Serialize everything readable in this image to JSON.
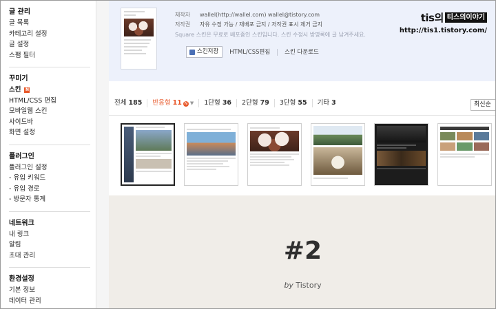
{
  "sidebar": {
    "sections": [
      {
        "title": "글 관리",
        "items": [
          "글 목록",
          "카테고리 설정",
          "글 설정",
          "스팸 필터"
        ]
      },
      {
        "title": "꾸미기",
        "items": [
          "스킨",
          "HTML/CSS 편집",
          "모바일웹 스킨",
          "사이드바",
          "화면 설정"
        ]
      },
      {
        "title": "플러그인",
        "items": [
          "플러그인 설정",
          "- 유입 키워드",
          "- 유입 경로",
          "- 방문자 통계"
        ]
      },
      {
        "title": "네트워크",
        "items": [
          "내 링크",
          "알림",
          "초대 관리"
        ]
      },
      {
        "title": "환경설정",
        "items": [
          "기본 정보",
          "데이터 관리"
        ]
      }
    ],
    "active_item": "스킨",
    "new_badge": "N"
  },
  "skin_info": {
    "maker_label": "제작자",
    "maker_value": "wallel(http://wallel.com) wallel@tistory.com",
    "copyright_label": "저작권",
    "copyright_value": "자유 수정 가능 / 재배포 금지 / 저작권 표시 제거 금지",
    "description": "Square 스킨은 무료로 배포중인 스킨입니다. 스킨 수정시 방명록에 글 남겨주세요.",
    "apply_button": "스킨저장",
    "html_css_link": "HTML/CSS편집",
    "download_link": "스킨 다운로드"
  },
  "brand": {
    "prefix": "tis의",
    "box_text": "티스의이야기",
    "url": "http://tis1.tistory.com/"
  },
  "filters": [
    {
      "label": "전체",
      "count": "185"
    },
    {
      "label": "반응형",
      "count": "11"
    },
    {
      "label": "1단형",
      "count": "36"
    },
    {
      "label": "2단형",
      "count": "79"
    },
    {
      "label": "3단형",
      "count": "55"
    },
    {
      "label": "기타",
      "count": "3"
    }
  ],
  "filter_new_badge": "N",
  "sort": {
    "selected": "최신순"
  },
  "preview": {
    "number": "#2",
    "by_prefix": "by",
    "by_name": "Tistory"
  },
  "colors": {
    "accent": "#e8582a",
    "info_bg": "#edf1fb",
    "preview_bg": "#f0ede8"
  }
}
